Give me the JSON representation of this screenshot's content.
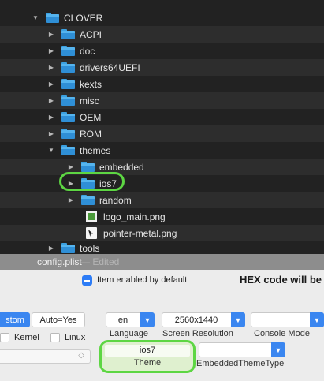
{
  "tree": {
    "root": {
      "label": "CLOVER",
      "expanded": true
    },
    "items": [
      {
        "label": "ACPI",
        "type": "folder",
        "expanded": false
      },
      {
        "label": "doc",
        "type": "folder",
        "expanded": false
      },
      {
        "label": "drivers64UEFI",
        "type": "folder",
        "expanded": false
      },
      {
        "label": "kexts",
        "type": "folder",
        "expanded": false
      },
      {
        "label": "misc",
        "type": "folder",
        "expanded": false
      },
      {
        "label": "OEM",
        "type": "folder",
        "expanded": false
      },
      {
        "label": "ROM",
        "type": "folder",
        "expanded": false
      },
      {
        "label": "themes",
        "type": "folder",
        "expanded": true
      },
      {
        "label": "embedded",
        "type": "folder",
        "expanded": false
      },
      {
        "label": "ios7",
        "type": "folder",
        "expanded": false,
        "highlighted": true
      },
      {
        "label": "random",
        "type": "folder",
        "expanded": false
      },
      {
        "label": "logo_main.png",
        "type": "file"
      },
      {
        "label": "pointer-metal.png",
        "type": "file"
      },
      {
        "label": "tools",
        "type": "folder",
        "expanded": false
      }
    ],
    "highlight_color": "#5dd643",
    "folder_color": "#2f8fd6"
  },
  "window": {
    "title": "config.plist",
    "title_suffix": "— Edited"
  },
  "panel": {
    "item_enabled_label": "Item enabled by default",
    "hex_label": "HEX code will be",
    "segment_custom": "stom",
    "segment_auto": "Auto=Yes",
    "check_kernel": "Kernel",
    "check_linux": "Linux",
    "language": {
      "value": "en",
      "caption": "Language"
    },
    "resolution": {
      "value": "2560x1440",
      "caption": "Screen Resolution"
    },
    "console": {
      "value": "",
      "caption": "Console Mode"
    },
    "theme": {
      "value": "ios7",
      "caption": "Theme"
    },
    "embedded_theme": {
      "value": "",
      "caption": "EmbeddedThemeType"
    },
    "accent_color": "#3a86f0"
  }
}
